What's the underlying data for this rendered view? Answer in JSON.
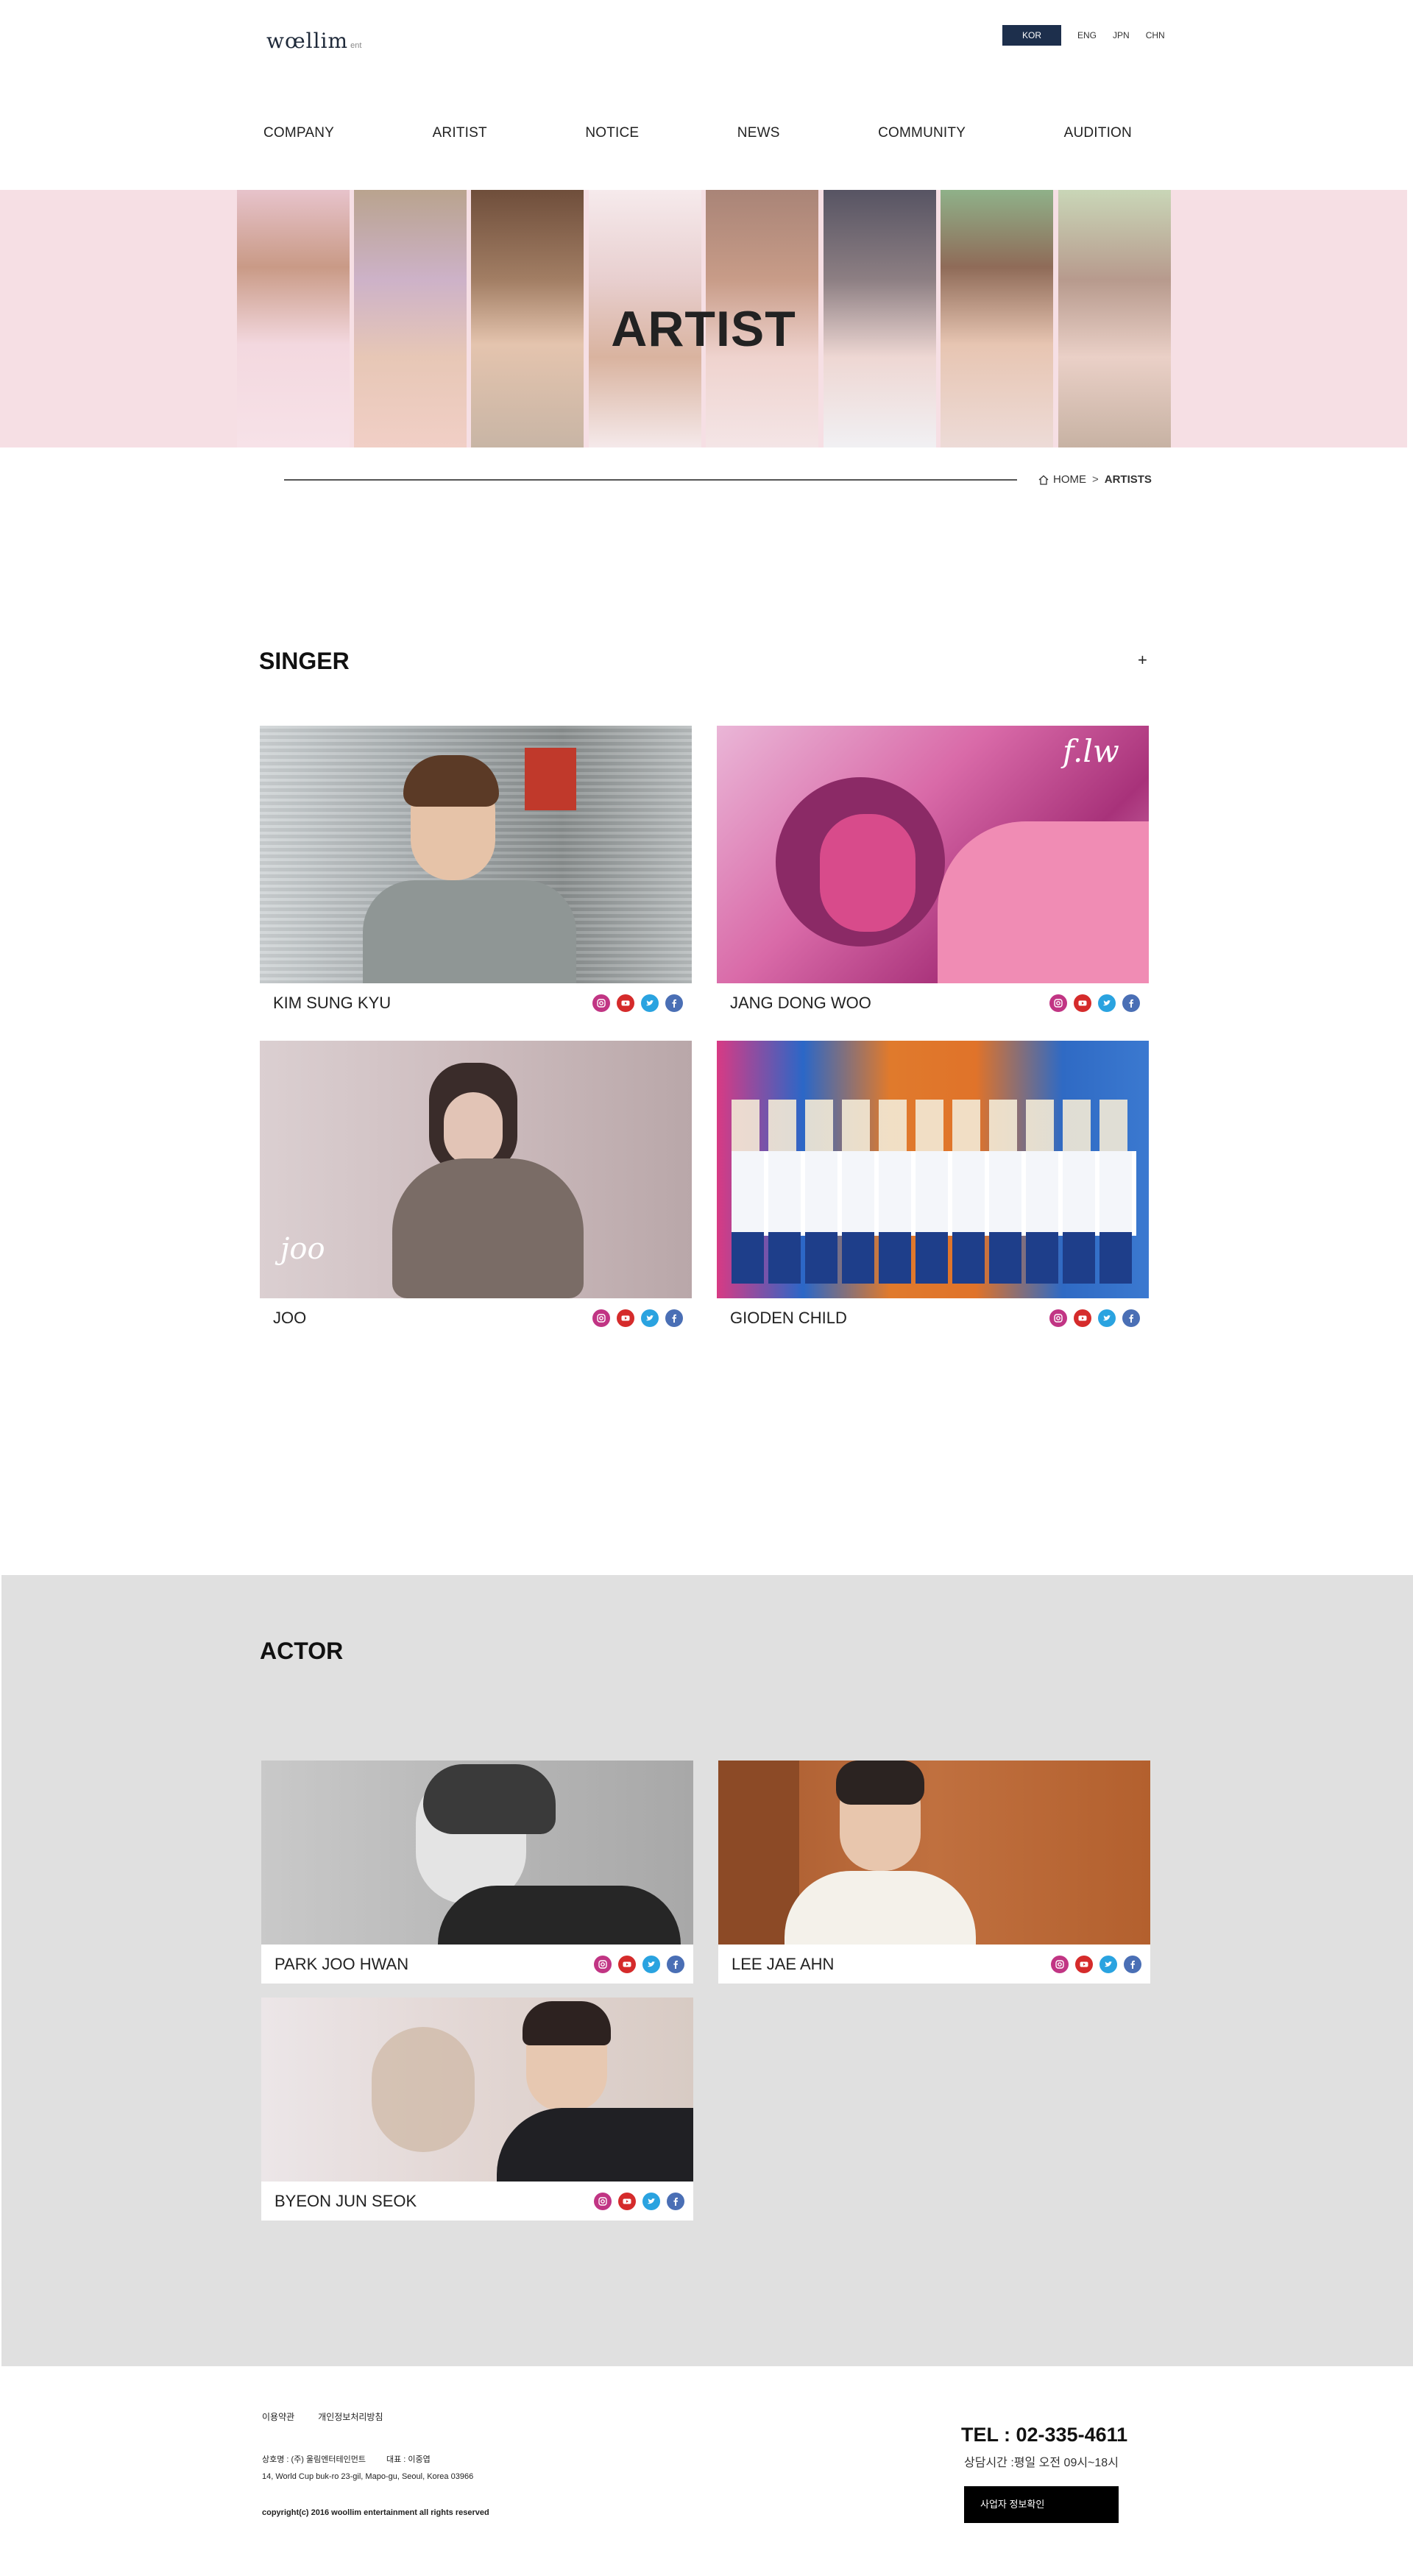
{
  "header": {
    "logo_main": "wœllim",
    "logo_sub": "ent",
    "languages": [
      {
        "label": "KOR",
        "active": true
      },
      {
        "label": "ENG",
        "active": false
      },
      {
        "label": "JPN",
        "active": false
      },
      {
        "label": "CHN",
        "active": false
      }
    ],
    "nav": [
      "COMPANY",
      "ARITIST",
      "NOTICE",
      "NEWS",
      "COMMUNITY",
      "AUDITION"
    ]
  },
  "banner": {
    "title": "ARTIST"
  },
  "breadcrumb": {
    "home": "HOME",
    "separator": ">",
    "current": "ARTISTS"
  },
  "singer": {
    "title": "SINGER",
    "more": "+",
    "cards": [
      {
        "name": "KIM SUNG KYU"
      },
      {
        "name": "JANG DONG WOO",
        "photo_text": "f.lw"
      },
      {
        "name": "JOO",
        "photo_text": "joo"
      },
      {
        "name": "GIODEN CHILD"
      }
    ]
  },
  "actor": {
    "title": "ACTOR",
    "cards": [
      {
        "name": "PARK JOO HWAN"
      },
      {
        "name": "LEE JAE AHN"
      },
      {
        "name": "BYEON JUN SEOK"
      }
    ]
  },
  "social_icons": [
    "instagram-icon",
    "youtube-icon",
    "twitter-icon",
    "facebook-icon"
  ],
  "colors": {
    "nav_active_lang": "#1d2f4c",
    "banner_bg": "#f6dfe4",
    "actor_bg": "#e0e0e0",
    "instagram": "#c13584",
    "youtube": "#d52b2b",
    "twitter": "#2aa3e0",
    "facebook": "#4a6fb5"
  },
  "footer": {
    "links": [
      "이용약관",
      "개인정보처리방침"
    ],
    "company": "상호명 : (주) 울림엔터테인먼트",
    "ceo": "대표 : 이중엽",
    "address": "14, World Cup buk-ro 23-gil, Mapo-gu, Seoul, Korea 03966",
    "copyright": "copyright(c) 2016 woollim entertainment all rights reserved",
    "tel": "TEL : 02-335-4611",
    "hours": "상담시간 :평일 오전 09시~18시",
    "biz_button": "사업자 정보확인"
  }
}
